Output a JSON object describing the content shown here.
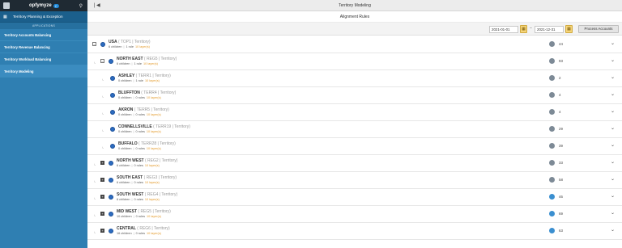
{
  "brand": {
    "name": "opfymyze",
    "badge": "C"
  },
  "sidebar": {
    "module": "Territory Planning & Exception",
    "section_header": "APPLICATIONS",
    "items": [
      {
        "label": "Territory Accounts Balancing"
      },
      {
        "label": "Territory Revenue Balancing"
      },
      {
        "label": "Territory Workload Balancing"
      },
      {
        "label": "Territory Modeling"
      }
    ]
  },
  "header": {
    "title": "Territory Modeling"
  },
  "page": {
    "title": "Alignment Rules"
  },
  "toolbar": {
    "date_from": "2021-01-01",
    "date_to": "2021-12-31",
    "sep": "–",
    "process_label": "Process Accounts"
  },
  "rows": [
    {
      "name": "USA",
      "code": "( TOP1 | Territory)",
      "children": "6 children",
      "rules": "1 rule",
      "layers": "10 layer(s)",
      "users": "44"
    },
    {
      "name": "NORTH EAST",
      "code": "( REG5 | Territory)",
      "children": "6 children",
      "rules": "1 rule",
      "layers": "10 layer(s)",
      "users": "93"
    },
    {
      "name": "ASHLEY",
      "code": "( TERR1 | Territory)",
      "children": "0 children",
      "rules": "1 rule",
      "layers": "10 layer(s)",
      "users": "2"
    },
    {
      "name": "BLUFFTON",
      "code": "( TERR4 | Territory)",
      "children": "0 children",
      "rules": "0 rules",
      "layers": "10 layer(s)",
      "users": "4"
    },
    {
      "name": "AKRON",
      "code": "( TERR5 | Territory)",
      "children": "0 children",
      "rules": "0 rules",
      "layers": "10 layer(s)",
      "users": "4"
    },
    {
      "name": "CONNELLSVILLE",
      "code": "( TERR19 | Territory)",
      "children": "0 children",
      "rules": "0 rules",
      "layers": "10 layer(s)",
      "users": "29"
    },
    {
      "name": "BUFFALO",
      "code": "( TERR28 | Territory)",
      "children": "0 children",
      "rules": "0 rules",
      "layers": "10 layer(s)",
      "users": "39"
    },
    {
      "name": "NORTH WEST",
      "code": "( REG2 | Territory)",
      "children": "6 children",
      "rules": "0 rules",
      "layers": "10 layer(s)",
      "users": "33"
    },
    {
      "name": "SOUTH EAST",
      "code": "( REG3 | Territory)",
      "children": "6 children",
      "rules": "0 rules",
      "layers": "10 layer(s)",
      "users": "58"
    },
    {
      "name": "SOUTH WEST",
      "code": "( REG4 | Territory)",
      "children": "6 children",
      "rules": "0 rules",
      "layers": "10 layer(s)",
      "users": "46"
    },
    {
      "name": "MID WEST",
      "code": "( REG5 | Territory)",
      "children": "10 children",
      "rules": "0 rules",
      "layers": "10 layer(s)",
      "users": "69"
    },
    {
      "name": "CENTRAL",
      "code": "( REG6 | Territory)",
      "children": "16 children",
      "rules": "0 rules",
      "layers": "10 layer(s)",
      "users": "63"
    }
  ],
  "colors": {
    "sidebar": "#2f7fb2",
    "accent": "#2d6cc0",
    "layers": "#e39a2a"
  }
}
